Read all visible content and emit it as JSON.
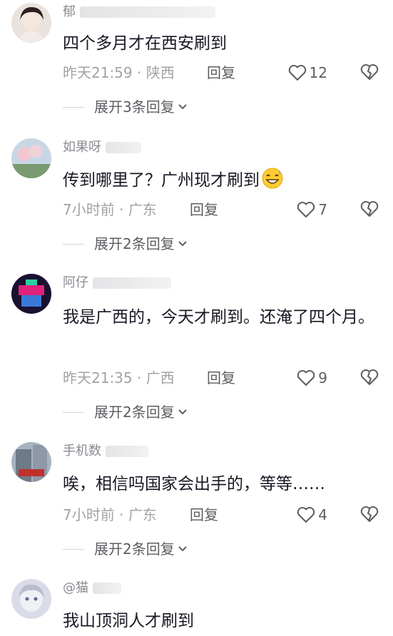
{
  "comments": [
    {
      "username": "郁",
      "text": "四个多月才在西安刷到",
      "time": "昨天21:59",
      "location": "陕西",
      "reply_label": "回复",
      "likes": "12",
      "expand": "展开3条回复"
    },
    {
      "username": "如果呀",
      "text": "传到哪里了？广州现才刷到",
      "emoji": "grinning-sweat-emoji",
      "time": "7小时前",
      "location": "广东",
      "reply_label": "回复",
      "likes": "7",
      "expand": "展开2条回复"
    },
    {
      "username": "阿仔",
      "text": "我是广西的，今天才刷到。还淹了四个月。",
      "time": "昨天21:35",
      "location": "广西",
      "reply_label": "回复",
      "likes": "9",
      "expand": "展开2条回复"
    },
    {
      "username": "手机数",
      "text": "唉，相信吗国家会出手的，等等……",
      "time": "7小时前",
      "location": "广东",
      "reply_label": "回复",
      "likes": "4",
      "expand": "展开2条回复"
    },
    {
      "username": "@猫",
      "text": "我山顶洞人才刷到"
    }
  ],
  "colors": {
    "text": "#161823",
    "meta": "#a1a2a7",
    "action": "#5c5d62"
  }
}
